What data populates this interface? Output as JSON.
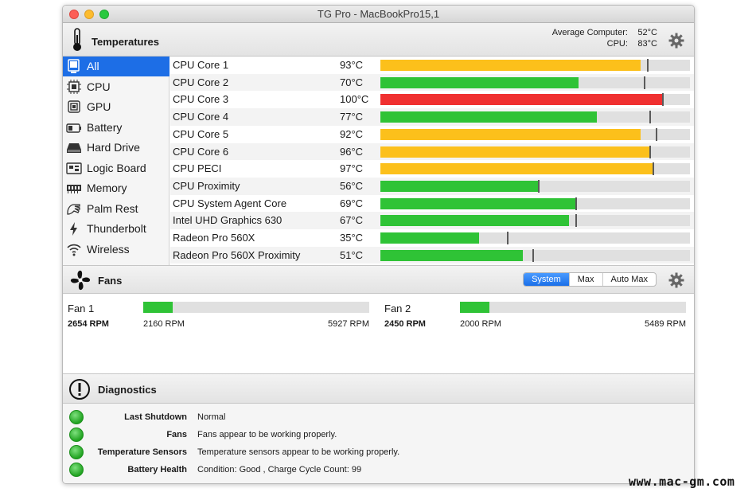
{
  "window": {
    "title": "TG Pro - MacBookPro15,1"
  },
  "temperatures": {
    "title": "Temperatures",
    "summary": {
      "avg_label": "Average Computer:",
      "avg_value": "52°C",
      "cpu_label": "CPU:",
      "cpu_value": "83°C"
    },
    "sidebar": [
      {
        "label": "All",
        "icon": "display-icon"
      },
      {
        "label": "CPU",
        "icon": "cpu-chip-icon"
      },
      {
        "label": "GPU",
        "icon": "gpu-chip-icon"
      },
      {
        "label": "Battery",
        "icon": "battery-icon"
      },
      {
        "label": "Hard Drive",
        "icon": "hard-drive-icon"
      },
      {
        "label": "Logic Board",
        "icon": "logic-board-icon"
      },
      {
        "label": "Memory",
        "icon": "memory-icon"
      },
      {
        "label": "Palm Rest",
        "icon": "palm-rest-icon"
      },
      {
        "label": "Thunderbolt",
        "icon": "thunderbolt-icon"
      },
      {
        "label": "Wireless",
        "icon": "wifi-icon"
      }
    ],
    "selected_sidebar": "All",
    "sensors": [
      {
        "name": "CPU Core 1",
        "value": "93°C",
        "level": 0.84,
        "max": 0.86,
        "color": "#fcc01b"
      },
      {
        "name": "CPU Core 2",
        "value": "70°C",
        "level": 0.64,
        "max": 0.85,
        "color": "#2fc336"
      },
      {
        "name": "CPU Core 3",
        "value": "100°C",
        "level": 0.91,
        "max": 0.91,
        "color": "#f03030"
      },
      {
        "name": "CPU Core 4",
        "value": "77°C",
        "level": 0.7,
        "max": 0.87,
        "color": "#2fc336"
      },
      {
        "name": "CPU Core 5",
        "value": "92°C",
        "level": 0.84,
        "max": 0.89,
        "color": "#fcc01b"
      },
      {
        "name": "CPU Core 6",
        "value": "96°C",
        "level": 0.87,
        "max": 0.87,
        "color": "#fcc01b"
      },
      {
        "name": "CPU PECI",
        "value": "97°C",
        "level": 0.88,
        "max": 0.88,
        "color": "#fcc01b"
      },
      {
        "name": "CPU Proximity",
        "value": "56°C",
        "level": 0.51,
        "max": 0.51,
        "color": "#2fc336"
      },
      {
        "name": "CPU System Agent Core",
        "value": "69°C",
        "level": 0.63,
        "max": 0.63,
        "color": "#2fc336"
      },
      {
        "name": "Intel UHD Graphics 630",
        "value": "67°C",
        "level": 0.61,
        "max": 0.63,
        "color": "#2fc336"
      },
      {
        "name": "Radeon Pro 560X",
        "value": "35°C",
        "level": 0.32,
        "max": 0.41,
        "color": "#2fc336"
      },
      {
        "name": "Radeon Pro 560X Proximity",
        "value": "51°C",
        "level": 0.46,
        "max": 0.49,
        "color": "#2fc336"
      },
      {
        "name": "",
        "value": "",
        "level": 0.33,
        "max": 0.39,
        "color": "#2fc336"
      }
    ]
  },
  "fans": {
    "title": "Fans",
    "modes": [
      "System",
      "Max",
      "Auto Max"
    ],
    "selected_mode": "System",
    "list": [
      {
        "name": "Fan 1",
        "rpm": "2654 RPM",
        "min": "2160 RPM",
        "max": "5927 RPM",
        "level": 0.13
      },
      {
        "name": "Fan 2",
        "rpm": "2450 RPM",
        "min": "2000 RPM",
        "max": "5489 RPM",
        "level": 0.13
      }
    ]
  },
  "diagnostics": {
    "title": "Diagnostics",
    "items": [
      {
        "label": "Last Shutdown",
        "value": "Normal",
        "status": "ok"
      },
      {
        "label": "Fans",
        "value": "Fans appear to be working properly.",
        "status": "ok"
      },
      {
        "label": "Temperature Sensors",
        "value": "Temperature sensors appear to be working properly.",
        "status": "ok"
      },
      {
        "label": "Battery Health",
        "value": "Condition: Good , Charge Cycle Count: 99",
        "status": "ok"
      }
    ]
  },
  "watermark": "www.mac-gm.com"
}
